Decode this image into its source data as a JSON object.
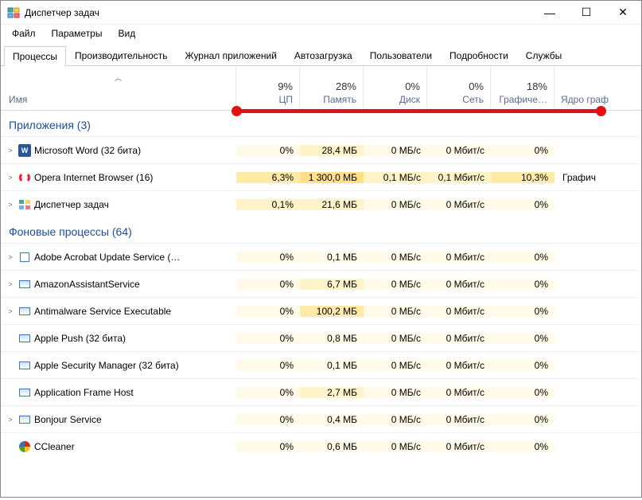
{
  "window": {
    "title": "Диспетчер задач",
    "controls": {
      "min": "—",
      "max": "☐",
      "close": "✕"
    }
  },
  "menu": [
    "Файл",
    "Параметры",
    "Вид"
  ],
  "tabs": [
    "Процессы",
    "Производительность",
    "Журнал приложений",
    "Автозагрузка",
    "Пользователи",
    "Подробности",
    "Службы"
  ],
  "active_tab": 0,
  "columns": {
    "name": "Имя",
    "cols": [
      {
        "pct": "9%",
        "label": "ЦП"
      },
      {
        "pct": "28%",
        "label": "Память"
      },
      {
        "pct": "0%",
        "label": "Диск"
      },
      {
        "pct": "0%",
        "label": "Сеть"
      },
      {
        "pct": "18%",
        "label": "Графиче…"
      }
    ],
    "extra": "Ядро граф"
  },
  "groups": [
    {
      "title": "Приложения (3)",
      "rows": [
        {
          "exp": true,
          "icon": "word",
          "name": "Microsoft Word (32 бита)",
          "cpu": "0%",
          "mem": "28,4 МБ",
          "disk": "0 МБ/с",
          "net": "0 Мбит/с",
          "gpu": "0%",
          "extra": "",
          "heat": [
            0,
            1,
            0,
            0,
            0
          ]
        },
        {
          "exp": true,
          "icon": "opera",
          "name": "Opera Internet Browser (16)",
          "cpu": "6,3%",
          "mem": "1 300,0 МБ",
          "disk": "0,1 МБ/с",
          "net": "0,1 Мбит/с",
          "gpu": "10,3%",
          "extra": "Графич",
          "heat": [
            2,
            3,
            1,
            1,
            2
          ]
        },
        {
          "exp": true,
          "icon": "tm",
          "name": "Диспетчер задач",
          "cpu": "0,1%",
          "mem": "21,6 МБ",
          "disk": "0 МБ/с",
          "net": "0 Мбит/с",
          "gpu": "0%",
          "extra": "",
          "heat": [
            1,
            1,
            0,
            0,
            0
          ]
        }
      ]
    },
    {
      "title": "Фоновые процессы (64)",
      "rows": [
        {
          "exp": true,
          "icon": "box",
          "name": "Adobe Acrobat Update Service (…",
          "cpu": "0%",
          "mem": "0,1 МБ",
          "disk": "0 МБ/с",
          "net": "0 Мбит/с",
          "gpu": "0%",
          "extra": "",
          "heat": [
            0,
            0,
            0,
            0,
            0
          ]
        },
        {
          "exp": true,
          "icon": "generic",
          "name": "AmazonAssistantService",
          "cpu": "0%",
          "mem": "6,7 МБ",
          "disk": "0 МБ/с",
          "net": "0 Мбит/с",
          "gpu": "0%",
          "extra": "",
          "heat": [
            0,
            1,
            0,
            0,
            0
          ]
        },
        {
          "exp": true,
          "icon": "generic",
          "name": "Antimalware Service Executable",
          "cpu": "0%",
          "mem": "100,2 МБ",
          "disk": "0 МБ/с",
          "net": "0 Мбит/с",
          "gpu": "0%",
          "extra": "",
          "heat": [
            0,
            2,
            0,
            0,
            0
          ]
        },
        {
          "exp": false,
          "icon": "generic",
          "name": "Apple Push (32 бита)",
          "cpu": "0%",
          "mem": "0,8 МБ",
          "disk": "0 МБ/с",
          "net": "0 Мбит/с",
          "gpu": "0%",
          "extra": "",
          "heat": [
            0,
            0,
            0,
            0,
            0
          ]
        },
        {
          "exp": false,
          "icon": "generic",
          "name": "Apple Security Manager (32 бита)",
          "cpu": "0%",
          "mem": "0,1 МБ",
          "disk": "0 МБ/с",
          "net": "0 Мбит/с",
          "gpu": "0%",
          "extra": "",
          "heat": [
            0,
            0,
            0,
            0,
            0
          ]
        },
        {
          "exp": false,
          "icon": "generic",
          "name": "Application Frame Host",
          "cpu": "0%",
          "mem": "2,7 МБ",
          "disk": "0 МБ/с",
          "net": "0 Мбит/с",
          "gpu": "0%",
          "extra": "",
          "heat": [
            0,
            1,
            0,
            0,
            0
          ]
        },
        {
          "exp": true,
          "icon": "generic",
          "name": "Bonjour Service",
          "cpu": "0%",
          "mem": "0,4 МБ",
          "disk": "0 МБ/с",
          "net": "0 Мбит/с",
          "gpu": "0%",
          "extra": "",
          "heat": [
            0,
            0,
            0,
            0,
            0
          ]
        },
        {
          "exp": false,
          "icon": "cc",
          "name": "CCleaner",
          "cpu": "0%",
          "mem": "0,6 МБ",
          "disk": "0 МБ/с",
          "net": "0 Мбит/с",
          "gpu": "0%",
          "extra": "",
          "heat": [
            0,
            0,
            0,
            0,
            0
          ]
        }
      ]
    }
  ]
}
